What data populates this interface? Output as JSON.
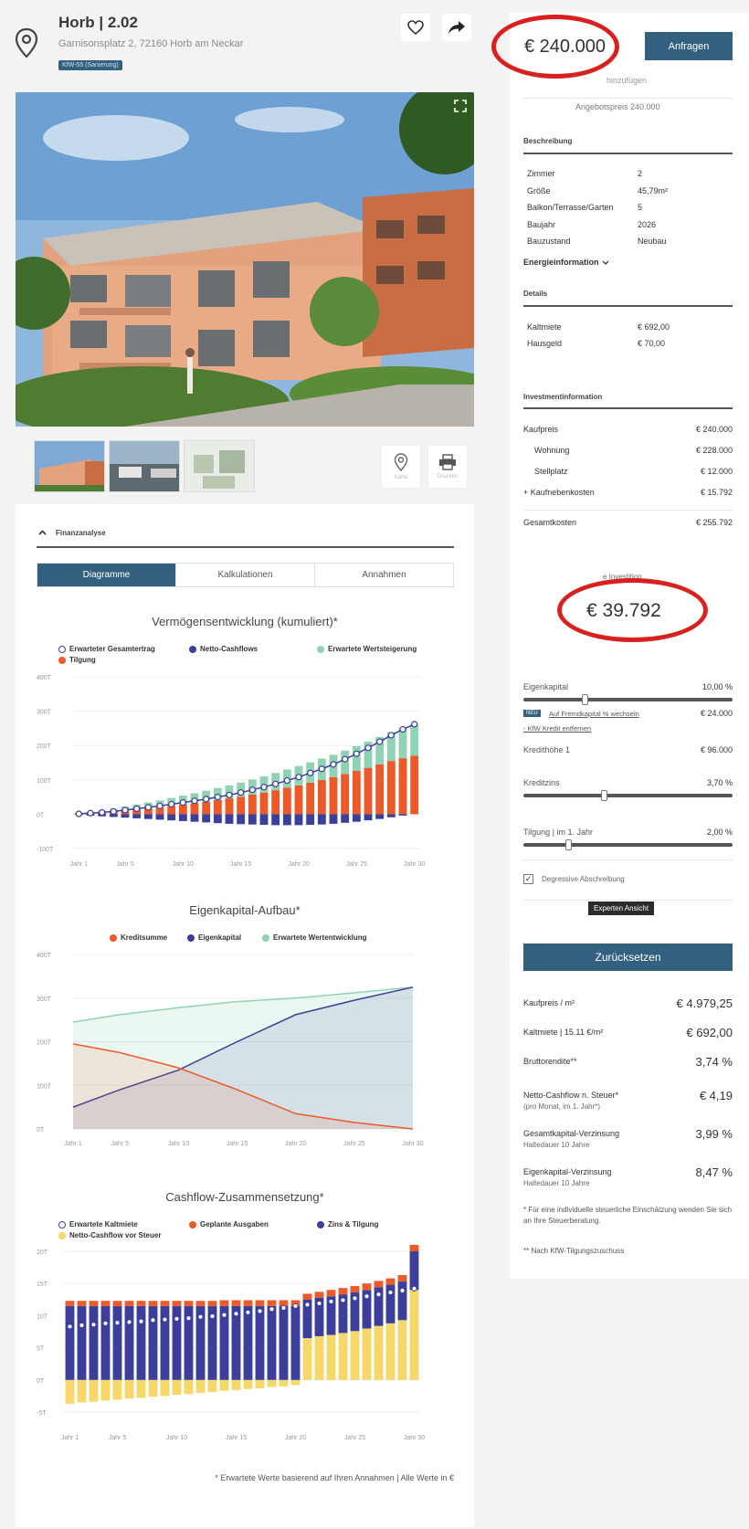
{
  "header": {
    "title": "Horb | 2.02",
    "address": "Garnisonsplatz 2, 72160 Horb am Neckar",
    "badge": "KfW-55 (Sanierung)"
  },
  "thumb_buttons": {
    "map": "Karte",
    "print": "Drucken"
  },
  "price_box": {
    "price": "€ 240.000",
    "cta": "Anfragen",
    "add_link": "hinzufügen",
    "offer": "Angebotspreis 240.000"
  },
  "beschreibung": {
    "heading": "Beschreibung",
    "rows": [
      {
        "k": "Zimmer",
        "v": "2"
      },
      {
        "k": "Größe",
        "v": "45,79m²"
      },
      {
        "k": "Balkon/Terrasse/Garten",
        "v": "5"
      },
      {
        "k": "Baujahr",
        "v": "2026"
      },
      {
        "k": "Bauzustand",
        "v": "Neubau"
      }
    ],
    "energy": "Energieinformation"
  },
  "details": {
    "heading": "Details",
    "rows": [
      {
        "k": "Kaltmiete",
        "v": "€ 692,00"
      },
      {
        "k": "Hausgeld",
        "v": "€ 70,00"
      }
    ]
  },
  "invest": {
    "heading": "Investmentinformation",
    "rows": [
      {
        "k": "Kaufpreis",
        "v": "€ 240.000"
      },
      {
        "k": "Wohnung",
        "v": "€ 228.000"
      },
      {
        "k": "Stellplatz",
        "v": "€ 12.000"
      },
      {
        "k": "+ Kaufnebenkosten",
        "v": "€ 15.792"
      },
      {
        "k": "Gesamtkosten",
        "v": "€ 255.792"
      }
    ],
    "ek_label": "e Investition",
    "ek_value": "€ 39.792"
  },
  "sliders": {
    "eigenkapital": {
      "label": "Eigenkapital",
      "value": "10,00 %",
      "pos": 0.28
    },
    "neu": "NEU",
    "fremd_link": "Auf Fremdkapital % wechseln",
    "fremd_value": "€ 24.000",
    "kfw_link": "- KfW Kredit entfernen",
    "kredithoehe": {
      "label": "Kredithöhe 1",
      "value": "€ 96.000"
    },
    "kreditzins": {
      "label": "Kreditzins",
      "value": "3,70 %",
      "pos": 0.37
    },
    "tilgung": {
      "label": "Tilgung | im 1. Jahr",
      "value": "2,00 %",
      "pos": 0.2
    },
    "degressiv": "Degressive Abschreibung",
    "experten": "Experten Ansicht",
    "reset": "Zurücksetzen"
  },
  "metrics": [
    {
      "k": "Kaufpreis / m²",
      "sub": "",
      "v": "€ 4.979,25"
    },
    {
      "k": "Kaltmiete | 15.11 €/m²",
      "sub": "",
      "v": "€ 692,00"
    },
    {
      "k": "Bruttorendite**",
      "sub": "",
      "v": "3,74 %"
    },
    {
      "k": "Netto-Cashflow n. Steuer*",
      "sub": "(pro Monat, im 1. Jahr*)",
      "v": "€ 4,19"
    },
    {
      "k": "Gesamtkapital-Verzinsung",
      "sub": "Haltedauer 10 Jahre",
      "v": "3,99 %"
    },
    {
      "k": "Eigenkapital-Verzinsung",
      "sub": "Haltedauer 10 Jahre",
      "v": "8,47 %"
    }
  ],
  "footnote1": "* Für eine individuelle steuerliche Einschätzung wenden Sie sich an Ihre Steuerberatung.",
  "footnote2": "** Nach KfW-Tilgungszuschuss",
  "finanz": {
    "heading": "Finanzanalyse",
    "tabs": [
      "Diagramme",
      "Kalkulationen",
      "Annahmen"
    ]
  },
  "footer_note": "* Erwartete Werte basierend auf Ihren Annahmen | Alle Werte in €",
  "colors": {
    "navy": "#34607f",
    "orange": "#ec5a2a",
    "blue": "#3b3f9a",
    "mint": "#8fd3b4",
    "yellow": "#f6d86a",
    "red": "#d8201f"
  },
  "chart_data": [
    {
      "type": "bar",
      "title": "Vermögensentwicklung (kumuliert)*",
      "legend": [
        "Erwarteter Gesamtertrag",
        "Netto-Cashflows",
        "Erwartete Wertsteigerung",
        "Tilgung"
      ],
      "x_ticks": [
        "Jahr 1",
        "Jahr 5",
        "Jahr 10",
        "Jahr 15",
        "Jahr 20",
        "Jahr 25",
        "Jahr 30"
      ],
      "y_ticks": [
        "400T",
        "300T",
        "200T",
        "100T",
        "0T",
        "-100T"
      ],
      "ylim": [
        -100,
        400
      ],
      "years": 30,
      "series": [
        {
          "name": "Tilgung",
          "values": [
            2,
            4,
            6,
            8,
            11,
            14,
            17,
            20,
            24,
            28,
            32,
            36,
            41,
            46,
            51,
            57,
            63,
            70,
            77,
            84,
            92,
            100,
            108,
            117,
            126,
            135,
            145,
            155,
            163,
            170
          ]
        },
        {
          "name": "Erwartete Wertsteigerung",
          "values": [
            1,
            3,
            5,
            8,
            11,
            14,
            17,
            20,
            23,
            26,
            29,
            32,
            35,
            38,
            41,
            44,
            47,
            50,
            53,
            56,
            59,
            62,
            65,
            68,
            72,
            76,
            80,
            84,
            88,
            92
          ]
        },
        {
          "name": "Netto-Cashflows",
          "values": [
            -2,
            -4,
            -6,
            -8,
            -10,
            -12,
            -14,
            -16,
            -18,
            -20,
            -22,
            -24,
            -26,
            -28,
            -29,
            -30,
            -31,
            -32,
            -32,
            -32,
            -31,
            -30,
            -28,
            -25,
            -22,
            -18,
            -14,
            -9,
            -4,
            0
          ]
        },
        {
          "name": "Erwarteter Gesamtertrag",
          "values": [
            1,
            3,
            5,
            8,
            12,
            16,
            20,
            24,
            29,
            34,
            39,
            44,
            50,
            56,
            63,
            71,
            79,
            88,
            98,
            108,
            120,
            132,
            145,
            160,
            176,
            193,
            211,
            230,
            247,
            262
          ]
        }
      ]
    },
    {
      "type": "area",
      "title": "Eigenkapital-Aufbau*",
      "legend": [
        "Kreditsumme",
        "Eigenkapital",
        "Erwartete Wertentwicklung"
      ],
      "x_ticks": [
        "Jahr 1",
        "Jahr 5",
        "Jahr 10",
        "Jahr 15",
        "Jahr 20",
        "Jahr 25",
        "Jahr 30"
      ],
      "y_ticks": [
        "400T",
        "300T",
        "200T",
        "100T",
        "0T"
      ],
      "ylim": [
        0,
        400
      ],
      "x": [
        1,
        5,
        10,
        15,
        20,
        25,
        30
      ],
      "series": [
        {
          "name": "Kreditsumme",
          "values": [
            195,
            175,
            140,
            90,
            35,
            15,
            0
          ]
        },
        {
          "name": "Eigenkapital",
          "values": [
            50,
            90,
            135,
            200,
            262,
            295,
            325
          ]
        },
        {
          "name": "Erwartete Wertentwicklung",
          "values": [
            245,
            262,
            278,
            292,
            300,
            312,
            325
          ]
        }
      ]
    },
    {
      "type": "bar",
      "title": "Cashflow-Zusammensetzung*",
      "legend": [
        "Erwartete Kaltmiete",
        "Geplante Ausgaben",
        "Zins & Tilgung",
        "Netto-Cashflow vor Steuer"
      ],
      "x_ticks": [
        "Jahr 1",
        "Jahr 5",
        "Jahr 10",
        "Jahr 15",
        "Jahr 20",
        "Jahr 25",
        "Jahr 30"
      ],
      "y_ticks": [
        "20T",
        "15T",
        "10T",
        "5T",
        "0T",
        "-5T"
      ],
      "ylim": [
        -5,
        20
      ],
      "years": 30,
      "series": [
        {
          "name": "Zins & Tilgung",
          "values": [
            11.5,
            11.5,
            11.5,
            11.5,
            11.5,
            11.5,
            11.5,
            11.5,
            11.5,
            11.5,
            11.5,
            11.5,
            11.5,
            11.5,
            11.5,
            11.5,
            11.5,
            11.5,
            11.5,
            11.5,
            6,
            6,
            6,
            6,
            6,
            6,
            6,
            6,
            6,
            6
          ]
        },
        {
          "name": "Geplante Ausgaben",
          "values": [
            0.8,
            0.8,
            0.8,
            0.8,
            0.8,
            0.8,
            0.8,
            0.8,
            0.8,
            0.8,
            0.8,
            0.8,
            0.8,
            0.9,
            0.9,
            0.9,
            0.9,
            0.9,
            0.9,
            0.9,
            0.9,
            0.9,
            1,
            1,
            1,
            1,
            1,
            1,
            1,
            1
          ]
        },
        {
          "name": "Netto-Cashflow vor Steuer",
          "values": [
            -3.7,
            -3.5,
            -3.4,
            -3.2,
            -3.1,
            -2.9,
            -2.8,
            -2.6,
            -2.5,
            -2.3,
            -2.2,
            -2.0,
            -1.9,
            -1.7,
            -1.6,
            -1.4,
            -1.3,
            -1.1,
            -1.0,
            -0.8,
            6.5,
            6.8,
            7.0,
            7.3,
            7.6,
            8.0,
            8.4,
            8.8,
            9.3,
            14
          ]
        },
        {
          "name": "Erwartete Kaltmiete",
          "values": [
            8.3,
            8.5,
            8.6,
            8.8,
            8.9,
            9.0,
            9.1,
            9.3,
            9.4,
            9.5,
            9.6,
            9.8,
            9.9,
            10.1,
            10.3,
            10.5,
            10.7,
            11.0,
            11.2,
            11.5,
            11.7,
            11.9,
            12.2,
            12.4,
            12.7,
            13.0,
            13.3,
            13.6,
            13.9,
            14.2
          ]
        }
      ]
    }
  ]
}
